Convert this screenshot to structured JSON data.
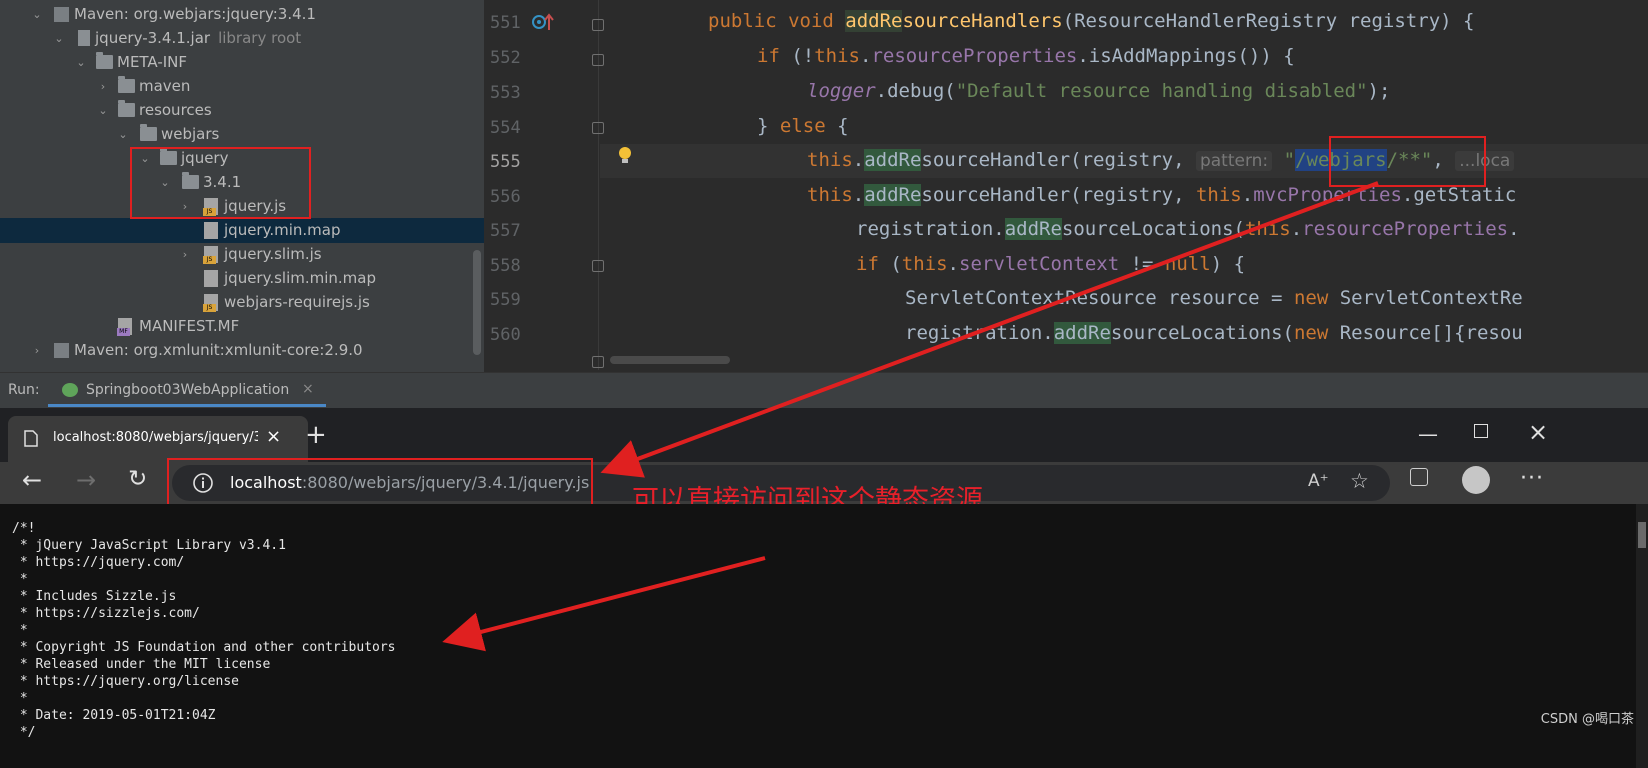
{
  "tree": {
    "rows": [
      {
        "label": "Maven: org.webjars:jquery:3.4.1"
      },
      {
        "label": "jquery-3.4.1.jar",
        "suffix": "library root"
      },
      {
        "label": "META-INF"
      },
      {
        "label": "maven"
      },
      {
        "label": "resources"
      },
      {
        "label": "webjars"
      },
      {
        "label": "jquery"
      },
      {
        "label": "3.4.1"
      },
      {
        "label": "jquery.js"
      },
      {
        "label": "jquery.min.map"
      },
      {
        "label": "jquery.slim.js"
      },
      {
        "label": "jquery.slim.min.map"
      },
      {
        "label": "webjars-requirejs.js"
      },
      {
        "label": "MANIFEST.MF"
      },
      {
        "label": "Maven: org.xmlunit:xmlunit-core:2.9.0"
      }
    ],
    "selected_index": 9
  },
  "editor": {
    "line_numbers": [
      "551",
      "552",
      "553",
      "554",
      "555",
      "556",
      "557",
      "558",
      "559",
      "560"
    ],
    "hint_pattern": "pattern:",
    "hint_loca": "...loca"
  },
  "run": {
    "label": "Run:",
    "config": "Springboot03WebApplication"
  },
  "browser": {
    "tab_title": "localhost:8080/webjars/jquery/3.",
    "url_host": "localhost",
    "url_path": ":8080/webjars/jquery/3.4.1/jquery.js",
    "annotation": "可以直接访问到这个静态资源",
    "content_lines": [
      "/*!",
      " * jQuery JavaScript Library v3.4.1",
      " * https://jquery.com/",
      " *",
      " * Includes Sizzle.js",
      " * https://sizzlejs.com/",
      " *",
      " * Copyright JS Foundation and other contributors",
      " * Released under the MIT license",
      " * https://jquery.org/license",
      " *",
      " * Date: 2019-05-01T21:04Z",
      " */"
    ]
  },
  "watermark": "CSDN @喝口茶",
  "colors": {
    "annotation_red": "#e02020",
    "selection": "#0d293e",
    "keyword": "#cc7832"
  },
  "icons": [
    "folder-icon",
    "library-icon",
    "jar-icon",
    "js-file-icon",
    "map-file-icon",
    "manifest-file-icon",
    "method-override-icon",
    "bulb-icon",
    "page-icon",
    "back-icon",
    "forward-icon",
    "refresh-icon",
    "info-icon",
    "read-aloud-icon",
    "favorite-icon",
    "collections-icon",
    "profile-icon",
    "more-icon",
    "minimize-icon",
    "maximize-icon",
    "close-icon",
    "new-tab-icon",
    "run-config-icon"
  ]
}
